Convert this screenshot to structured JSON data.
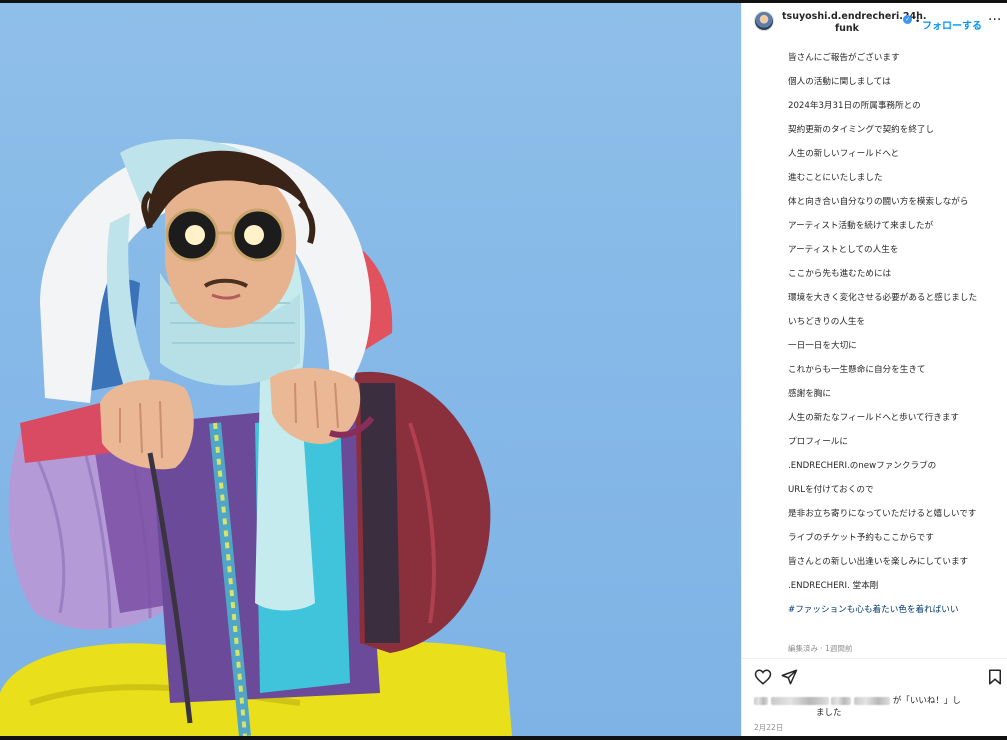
{
  "post": {
    "username_line1": "tsuyoshi.d.endrecheri.24h.",
    "username_line2": "funk",
    "separator": "•",
    "follow_label": "フォローする",
    "more_label": "···"
  },
  "caption": {
    "lines": [
      "皆さんにご報告がございます",
      "個人の活動に関しましては",
      "2024年3月31日の所属事務所との",
      "契約更新のタイミングで契約を終了し",
      "人生の新しいフィールドへと",
      "進むことにいたしました",
      "体と向き合い自分なりの闘い方を模索しながら",
      "アーティスト活動を続けて来ましたが",
      "アーティストとしての人生を",
      "ここから先も進むためには",
      "環境を大きく変化させる必要があると感じました",
      "いちどきりの人生を",
      "一日一日を大切に",
      "これからも一生懸命に自分を生きて",
      "感謝を胸に",
      "人生の新たなフィールドへと歩いて行きます",
      "プロフィールに",
      ".ENDRECHERI.のnewファンクラブの",
      "URLを付けておくので",
      "是非お立ち寄りになっていただけると嬉しいです",
      "ライブのチケット予約もここからです",
      "皆さんとの新しい出逢いを楽しみにしています",
      ".ENDRECHERI. 堂本剛"
    ],
    "hashtag": "#ファッションも心も着たい色を着ればいい",
    "edited_meta": "編集済み · 1週間前"
  },
  "engagement": {
    "likes_suffix": "が「いいね！」し",
    "likes_line2": "ました",
    "date": "2月22日"
  },
  "colors": {
    "sky": "#86b9e8",
    "link": "#0095f6",
    "text": "#262626",
    "muted": "#8e8e8e"
  },
  "icons": {
    "like": "heart-icon",
    "share": "send-icon",
    "save": "bookmark-icon",
    "verified": "verified-badge-icon"
  }
}
